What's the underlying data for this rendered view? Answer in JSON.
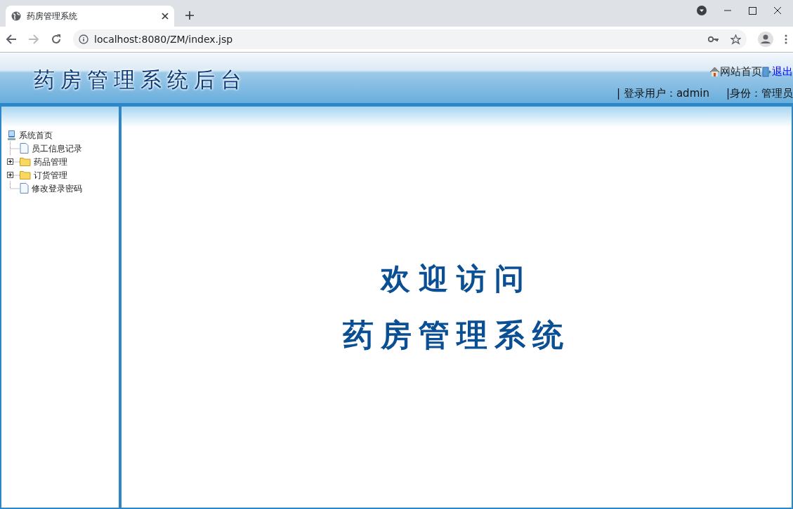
{
  "browser": {
    "tab_title": "药房管理系统",
    "address": "localhost:8080/ZM/index.jsp"
  },
  "header": {
    "title": "药房管理系统后台",
    "links": [
      {
        "label": "网站首页",
        "kind": "home"
      },
      {
        "label": "退出",
        "kind": "exit"
      }
    ],
    "user_label": "| 登录用户：admin",
    "role_label": "|身份：管理员"
  },
  "tree": {
    "root": "系统首页",
    "children": [
      {
        "label": "员工信息记录",
        "kind": "page"
      },
      {
        "label": "药品管理",
        "kind": "folder",
        "expanded": false
      },
      {
        "label": "订货管理",
        "kind": "folder",
        "expanded": false
      },
      {
        "label": "修改登录密码",
        "kind": "page"
      }
    ]
  },
  "welcome": [
    "欢迎访问",
    "药房管理系统"
  ]
}
